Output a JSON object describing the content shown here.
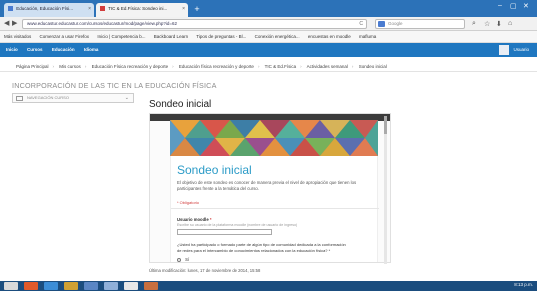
{
  "browser": {
    "tabs": [
      {
        "label": "Educación, Educación Físi...",
        "color": "#cfe0f2"
      },
      {
        "label": "TIC & Ed.Física: Sondeo ini...",
        "color": "#f3f3f3"
      }
    ],
    "new_tab": "+",
    "window_controls": {
      "minimize": "–",
      "maximize": "▢",
      "close": "✕"
    },
    "url": "www.educastur.educastur.com/cursos/educastur/mod/page/view.php?id=62",
    "search_placeholder": "Google",
    "back": "◀",
    "forward": "▶",
    "reload": "C",
    "toolbar_icons": [
      "search-icon",
      "star-icon",
      "home-icon",
      "download-icon"
    ],
    "bookmarks": [
      "Más visitados",
      "Comenzar a usar Firefox",
      "Inicio | Competencia b...",
      "Backboard Learn",
      "Tipos de preguntas - Bl...",
      "Conexión energética...",
      "encuestas en moodle",
      "mafluma"
    ]
  },
  "site": {
    "nav": [
      "Inicio",
      "Cursos",
      "Educación",
      "Idioma"
    ],
    "user": "Usuario"
  },
  "breadcrumbs": [
    "Página Principal",
    "Mis cursos",
    "Educación Física recreación y deporte",
    "Educación física recreación y deporte",
    "TIC & Ed.Física",
    "Actividades semanal",
    "Sondeo inicial"
  ],
  "course_title": "INCORPORACIÓN DE LAS TIC EN LA EDUCACIÓN FÍSICA",
  "sidebar_select": "NAVEGACIÓN CURSO",
  "page_title": "Sondeo inicial",
  "form": {
    "title": "Sondeo inicial",
    "description": "El objetivo de este sondeo es conocer de manera previa el nivel de apropiación que tienen los participantes frente a la temática del curso.",
    "required_note": "* Obligatorio",
    "q1_label": "Usuario moodle",
    "q1_help": "Escribe su usuario de la plataforma moodle (nombre de usuario de ingreso)",
    "q2_label": "¿Usted ha participado o formado parte de algún tipo de comunidad dedicada a la conformación de redes para el intercambio de conocimientos relacionados con la educación física? *",
    "option_1": "Sí"
  },
  "last_modified": "Última modificación: lunes, 17 de noviembre de 2014, 15:58",
  "taskbar": {
    "apps": [
      "#d9d9d9",
      "#e05a2b",
      "#3c8dd6",
      "#cfa133",
      "#5a86c4",
      "#8fb0d9",
      "#e8e8e8",
      "#c76f3f"
    ],
    "clock": "8:13 p.m."
  },
  "colors": {
    "accent": "#1f77c0",
    "form_title": "#2b9bc7",
    "required": "#d23c3c"
  }
}
